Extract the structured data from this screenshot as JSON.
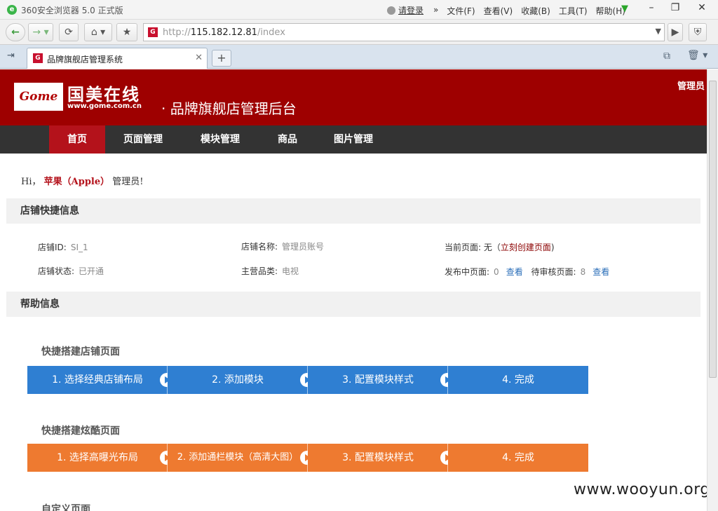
{
  "browser": {
    "app_title": "360安全浏览器 5.0 正式版",
    "login": "请登录",
    "menus": [
      "文件(F)",
      "查看(V)",
      "收藏(B)",
      "工具(T)",
      "帮助(H)"
    ],
    "url_prefix": "http://",
    "url_host": "115.182.12.81",
    "url_path": "/index",
    "tab_title": "品牌旗舰店管理系统",
    "icons": [
      "back-icon",
      "forward-icon",
      "refresh-icon",
      "home-icon",
      "star-icon",
      "shield-icon",
      "close-icon",
      "plus-icon",
      "trash-icon"
    ]
  },
  "header": {
    "logo_mark": "Gome",
    "logo_cn": "国美在线",
    "logo_url": "www.gome.com.cn",
    "subtitle": "· 品牌旗舰店管理后台",
    "admin": "管理员"
  },
  "nav": {
    "items": [
      "首页",
      "页面管理",
      "模块管理",
      "商品",
      "图片管理"
    ],
    "active_index": 0
  },
  "greeting": {
    "hi": "Hi，",
    "brand": "苹果（Apple）",
    "role": "管理员!"
  },
  "shop_info": {
    "title": "店铺快捷信息",
    "shop_id_label": "店铺ID:",
    "shop_id": "SI_1",
    "shop_name_label": "店铺名称:",
    "shop_name": "管理员账号",
    "current_page_label": "当前页面: 无（",
    "create_link": "立刻创建页面",
    "current_page_close": ")",
    "status_label": "店铺状态:",
    "status": "已开通",
    "category_label": "主营品类:",
    "category": "电视",
    "published_label": "发布中页面:",
    "published_count": "0",
    "view_link": "查看",
    "pending_label": "待审核页面:",
    "pending_count": "8"
  },
  "help": {
    "title": "帮助信息",
    "flow1_title": "快捷搭建店铺页面",
    "flow1_steps": [
      "1. 选择经典店铺布局",
      "2. 添加模块",
      "3. 配置模块样式",
      "4. 完成"
    ],
    "flow1_color": "#2f7fd2",
    "flow2_title": "快捷搭建炫酷页面",
    "flow2_steps": [
      "1. 选择高曝光布局",
      "2. 添加通栏模块（高清大图）",
      "3. 配置模块样式",
      "4. 完成"
    ],
    "flow2_color": "#ee7a30",
    "flow3_title": "自定义页面"
  },
  "watermark": "www.wooyun.org"
}
